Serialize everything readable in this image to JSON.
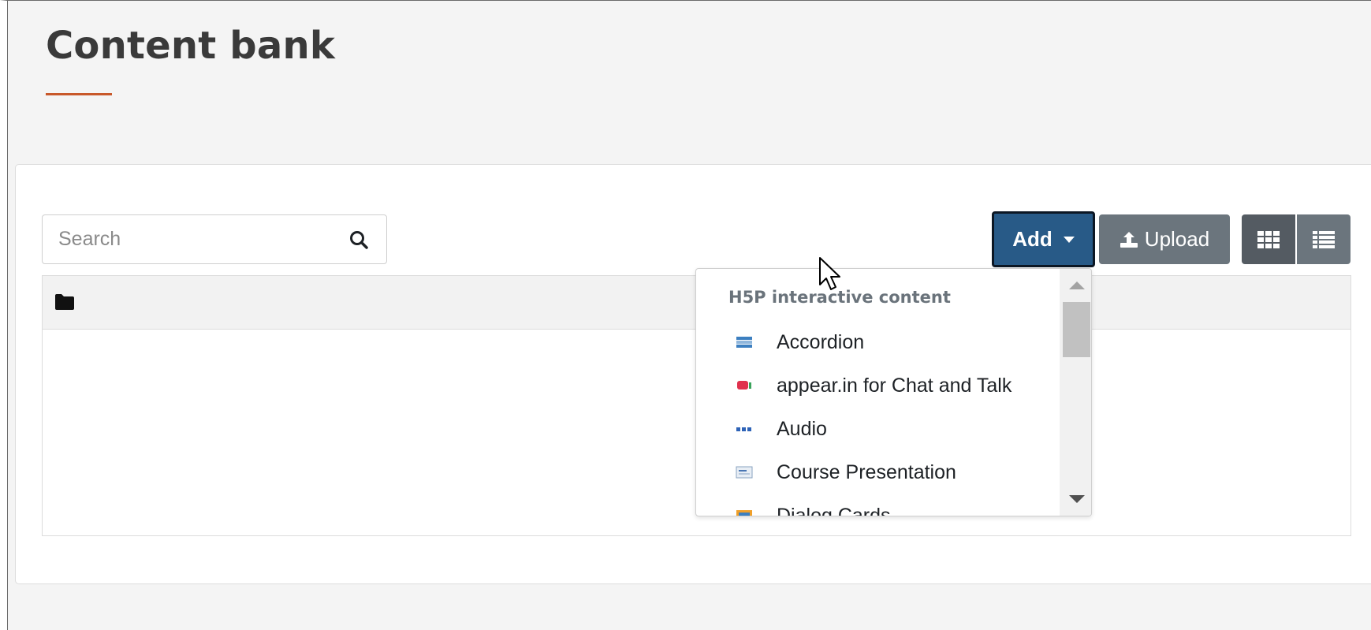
{
  "page": {
    "title": "Content bank"
  },
  "search": {
    "placeholder": "Search",
    "icon": "search-icon"
  },
  "toolbar": {
    "add_label": "Add",
    "upload_label": "Upload",
    "grid_view_icon": "grid-icon",
    "list_view_icon": "list-icon"
  },
  "table": {
    "folder_icon": "folder-icon"
  },
  "add_menu": {
    "header": "H5P interactive content",
    "items": [
      {
        "label": "Accordion",
        "icon": "accordion-icon"
      },
      {
        "label": "appear.in for Chat and Talk",
        "icon": "appear-in-icon"
      },
      {
        "label": "Audio",
        "icon": "audio-icon"
      },
      {
        "label": "Course Presentation",
        "icon": "course-presentation-icon"
      },
      {
        "label": "Dialog Cards",
        "icon": "dialog-cards-icon"
      }
    ]
  },
  "colors": {
    "accent_underline": "#c8582a",
    "add_button": "#285a87",
    "secondary_button": "#6b757d",
    "page_background": "#f4f4f4"
  }
}
